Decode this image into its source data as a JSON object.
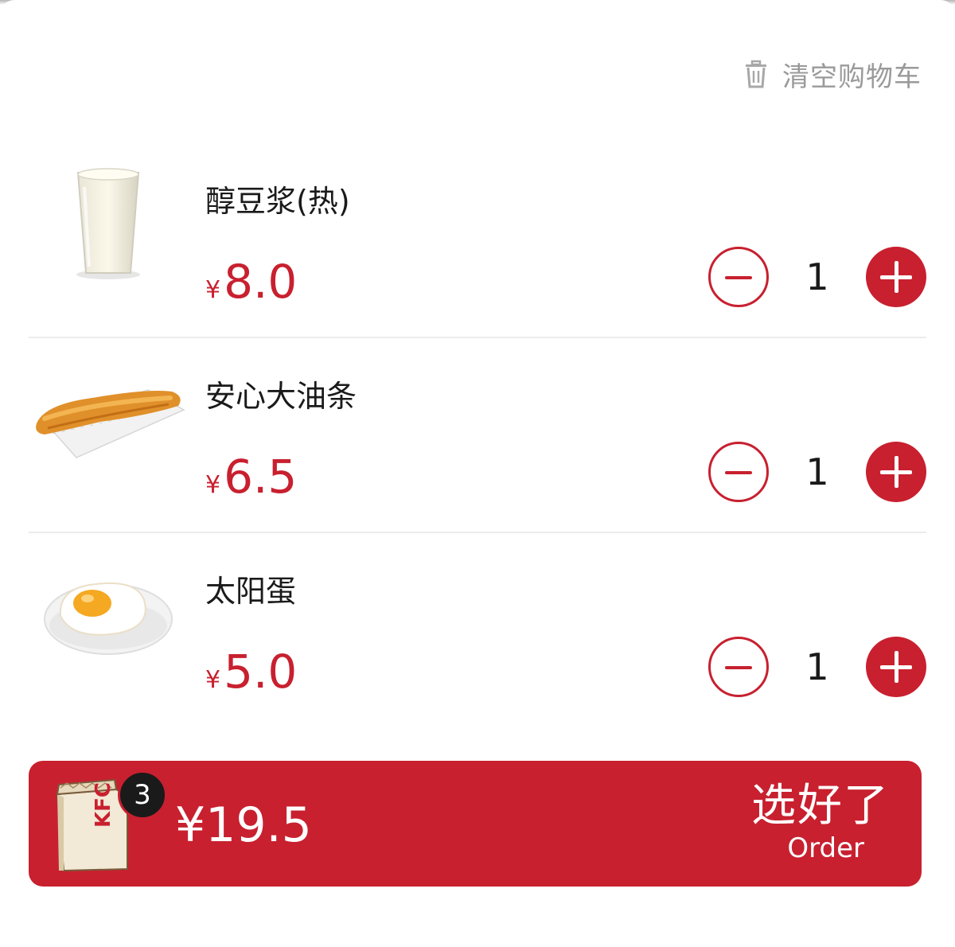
{
  "cart": {
    "clear_label": "清空购物车",
    "items": [
      {
        "name": "醇豆浆(热)",
        "currency": "¥",
        "price": "8.0",
        "qty": "1"
      },
      {
        "name": "安心大油条",
        "currency": "¥",
        "price": "6.5",
        "qty": "1"
      },
      {
        "name": "太阳蛋",
        "currency": "¥",
        "price": "5.0",
        "qty": "1"
      }
    ]
  },
  "order_bar": {
    "count": "3",
    "total": "¥19.5",
    "button_cn": "选好了",
    "button_en": "Order",
    "bag_text": "KFC"
  },
  "colors": {
    "accent": "#c8202f",
    "muted": "#9a9a9a"
  }
}
